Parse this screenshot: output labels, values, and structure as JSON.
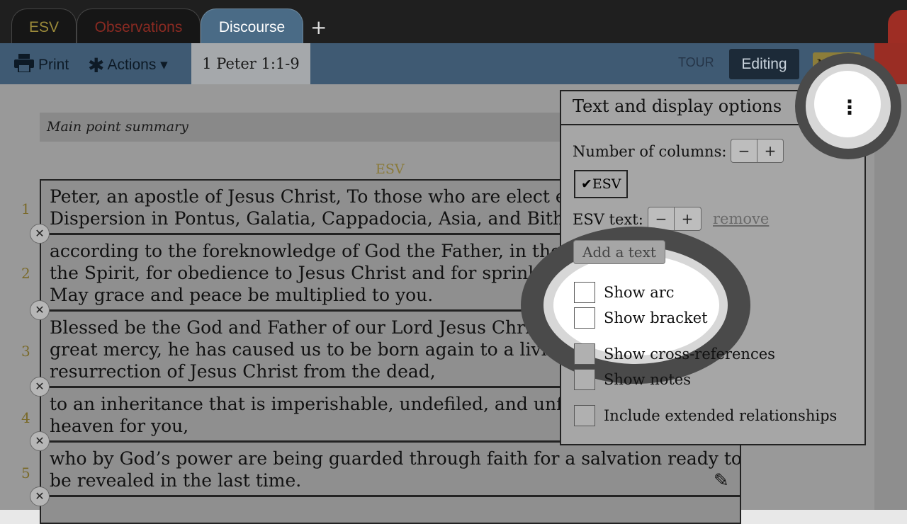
{
  "tabs": [
    {
      "label": "ESV",
      "color": "#9b8a3a"
    },
    {
      "label": "Observations",
      "color": "#8a2a22"
    },
    {
      "label": "Discourse",
      "active": true
    }
  ],
  "add_tab_label": "+",
  "toolbar": {
    "print_label": "Print",
    "actions_label": "Actions ▾",
    "reference": "1 Peter 1:1-9",
    "tour_label": "TOUR",
    "editing_label": "Editing",
    "notes_label": "Notes"
  },
  "summary_label": "Main point summary",
  "text_heading": "ESV",
  "verses": [
    {
      "num": "1",
      "lines": [
        "Peter, an apostle of Jesus Christ, To those who are elect e",
        "Dispersion in Pontus, Galatia, Cappadocia, Asia, and Bith"
      ]
    },
    {
      "num": "2",
      "lines": [
        "according to the foreknowledge of God the Father, in the",
        "the Spirit, for obedience to Jesus Christ and for sprinkli",
        "May grace and peace be multiplied to you."
      ]
    },
    {
      "num": "3",
      "lines": [
        "Blessed be the God and Father of our Lord Jesus Christ! A",
        "great mercy, he has caused us to be born again to a living",
        "resurrection of Jesus Christ from the dead,"
      ]
    },
    {
      "num": "4",
      "lines": [
        "to an inheritance that is imperishable, undefiled, and unf",
        "heaven for you,"
      ]
    },
    {
      "num": "5",
      "lines": [
        "who by God’s power are being guarded through faith for a salvation ready to",
        "be revealed in the last time."
      ]
    }
  ],
  "remove_verse_symbol": "✕",
  "panel": {
    "title": "Text and display options",
    "menu_symbol": "⋮",
    "columns_label": "Number of columns:",
    "minus": "−",
    "plus": "+",
    "esv_checked_label": "✔ESV",
    "esv_text_label": "ESV text:",
    "remove_label": "remove",
    "add_text_label": "Add a text",
    "options": [
      {
        "label": "Show arc",
        "checked": false
      },
      {
        "label": "Show bracket",
        "checked": false
      },
      {
        "label": "Show cross-references",
        "checked": false
      },
      {
        "label": "Show notes",
        "checked": false
      },
      {
        "label": "Include extended relationships",
        "checked": false
      }
    ]
  }
}
